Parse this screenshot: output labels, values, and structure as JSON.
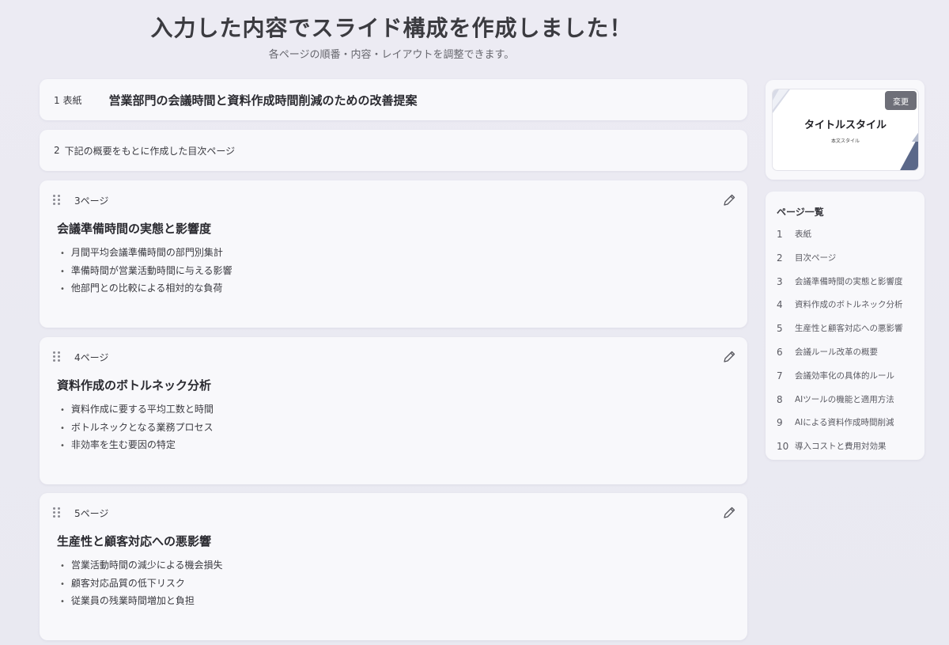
{
  "header": {
    "title": "入力した内容でスライド構成を作成しました！",
    "subtitle": "各ページの順番・内容・レイアウトを調整できます。"
  },
  "cover": {
    "number_label": "1  表紙",
    "title": "営業部門の会議時間と資料作成時間削減のための改善提案"
  },
  "toc": {
    "number": "2",
    "text": "下記の概要をもとに作成した目次ページ"
  },
  "pages": [
    {
      "label": "3ページ",
      "title": "会議準備時間の実態と影響度",
      "bullets": [
        "月間平均会議準備時間の部門別集計",
        "準備時間が営業活動時間に与える影響",
        "他部門との比較による相対的な負荷"
      ]
    },
    {
      "label": "4ページ",
      "title": "資料作成のボトルネック分析",
      "bullets": [
        "資料作成に要する平均工数と時間",
        "ボトルネックとなる業務プロセス",
        "非効率を生む要因の特定"
      ]
    },
    {
      "label": "5ページ",
      "title": "生産性と顧客対応への悪影響",
      "bullets": [
        "営業活動時間の減少による機会損失",
        "顧客対応品質の低下リスク",
        "従業員の残業時間増加と負担"
      ]
    }
  ],
  "style_panel": {
    "thumb_title": "タイトルスタイル",
    "thumb_body": "本文スタイル",
    "change_label": "変更"
  },
  "page_list": {
    "heading": "ページ一覧",
    "items": [
      {
        "num": "1",
        "label": "表紙"
      },
      {
        "num": "2",
        "label": "目次ページ"
      },
      {
        "num": "3",
        "label": "会議準備時間の実態と影響度"
      },
      {
        "num": "4",
        "label": "資料作成のボトルネック分析"
      },
      {
        "num": "5",
        "label": "生産性と顧客対応への悪影響"
      },
      {
        "num": "6",
        "label": "会議ルール改革の概要"
      },
      {
        "num": "7",
        "label": "会議効率化の具体的ルール"
      },
      {
        "num": "8",
        "label": "AIツールの機能と適用方法"
      },
      {
        "num": "9",
        "label": "AIによる資料作成時間削減"
      },
      {
        "num": "10",
        "label": "導入コストと費用対効果"
      }
    ]
  },
  "colors": {
    "accent_dark": "#4f5a7a",
    "button_bg": "#6e6f78",
    "background": "#ecebf3"
  },
  "icons": {
    "drag": "drag-handle-icon",
    "edit": "pencil-icon"
  }
}
